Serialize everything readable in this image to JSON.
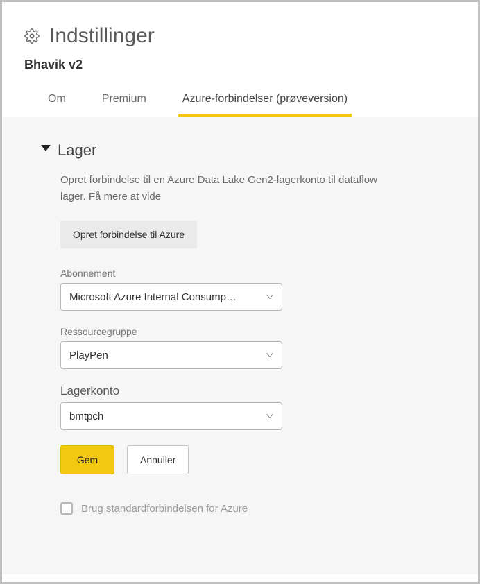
{
  "header": {
    "title": "Indstillinger",
    "subtitle": "Bhavik v2"
  },
  "tabs": {
    "about": "Om",
    "premium": "Premium",
    "azure": "Azure-forbindelser (prøveversion)"
  },
  "section": {
    "title": "Lager",
    "desc_prefix": "Opret forbindelse til en Azure Data Lake Gen2-lagerkonto til dataflow lager. ",
    "desc_link": "Få mere at vide",
    "connect_btn": "Opret forbindelse til Azure"
  },
  "fields": {
    "subscription": {
      "label": "Abonnement",
      "value": "Microsoft Azure Internal Consump…"
    },
    "resource_group": {
      "label": "Ressourcegruppe",
      "value": "PlayPen"
    },
    "storage_account": {
      "label": "Lagerkonto",
      "value": "bmtpch"
    }
  },
  "buttons": {
    "save": "Gem",
    "cancel": "Annuller"
  },
  "checkbox": {
    "label": "Brug standardforbindelsen for Azure"
  }
}
